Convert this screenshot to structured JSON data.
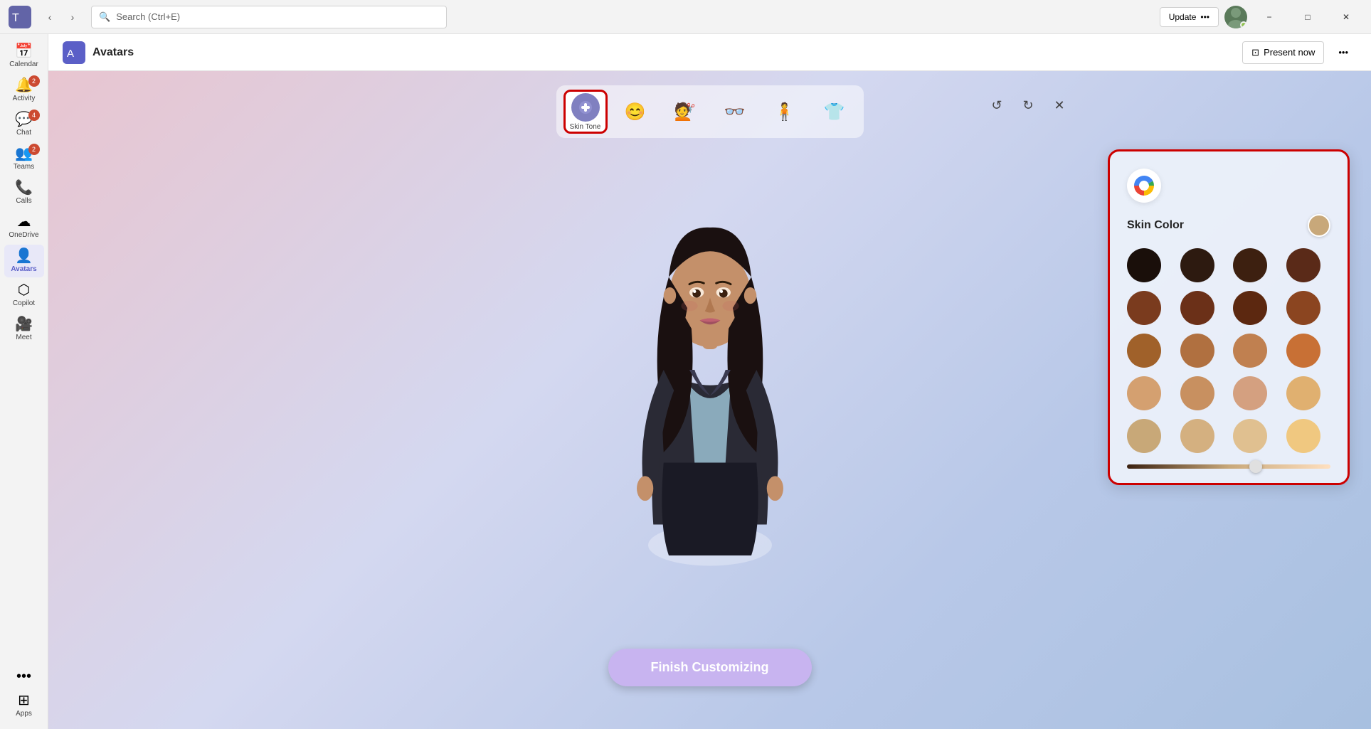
{
  "titlebar": {
    "search_placeholder": "Search (Ctrl+E)",
    "update_label": "Update",
    "update_dots": "•••",
    "minimize_label": "−",
    "maximize_label": "□",
    "close_label": "✕"
  },
  "sidebar": {
    "items": [
      {
        "id": "calendar",
        "label": "Calendar",
        "icon": "📅",
        "badge": null,
        "active": false
      },
      {
        "id": "activity",
        "label": "Activity",
        "icon": "🔔",
        "badge": "2",
        "active": false
      },
      {
        "id": "chat",
        "label": "Chat",
        "icon": "💬",
        "badge": "4",
        "active": false
      },
      {
        "id": "teams",
        "label": "Teams",
        "icon": "👥",
        "badge": "2",
        "active": false
      },
      {
        "id": "calls",
        "label": "Calls",
        "icon": "📞",
        "badge": null,
        "active": false
      },
      {
        "id": "onedrive",
        "label": "OneDrive",
        "icon": "☁",
        "badge": null,
        "active": false
      },
      {
        "id": "avatars",
        "label": "Avatars",
        "icon": "👤",
        "badge": null,
        "active": true
      },
      {
        "id": "copilot",
        "label": "Copilot",
        "icon": "⬡",
        "badge": null,
        "active": false
      },
      {
        "id": "meet",
        "label": "Meet",
        "icon": "🎥",
        "badge": null,
        "active": false
      },
      {
        "id": "more",
        "label": "•••",
        "icon": "•••",
        "badge": null,
        "active": false
      },
      {
        "id": "apps",
        "label": "Apps",
        "icon": "⊞",
        "badge": null,
        "active": false
      }
    ]
  },
  "header": {
    "app_icon_char": "A",
    "title": "Avatars",
    "present_label": "Present now",
    "more_label": "•••"
  },
  "tabs": [
    {
      "id": "skin-tone",
      "label": "Skin Tone",
      "icon": "skin",
      "active": true
    },
    {
      "id": "face",
      "label": "",
      "icon": "face",
      "active": false
    },
    {
      "id": "hair",
      "label": "",
      "icon": "hair",
      "active": false
    },
    {
      "id": "accessories",
      "label": "",
      "icon": "accessories",
      "active": false
    },
    {
      "id": "body",
      "label": "",
      "icon": "body",
      "active": false
    },
    {
      "id": "clothing",
      "label": "",
      "icon": "clothing",
      "active": false
    }
  ],
  "editor_controls": {
    "undo_label": "↺",
    "redo_label": "↻",
    "close_label": "✕"
  },
  "skin_panel": {
    "title": "Skin Color",
    "colors_row1": [
      "#1a0f0a",
      "#2d1a10",
      "#3d2010",
      "#5a2a18"
    ],
    "colors_row2": [
      "#7a3b1e",
      "#6b3018",
      "#5c2810",
      "#8b4520"
    ],
    "colors_row3": [
      "#a0612a",
      "#b07040",
      "#c08050",
      "#c87035"
    ],
    "colors_row4": [
      "#d4a070",
      "#c89060",
      "#d4a080",
      "#e0b070"
    ],
    "colors_row5": [
      "#c8a878",
      "#d4b080",
      "#e0c090",
      "#f0c880"
    ],
    "selected_color": "#d4a070",
    "slider_value": 60
  },
  "finish_button": {
    "label": "Finish Customizing"
  }
}
